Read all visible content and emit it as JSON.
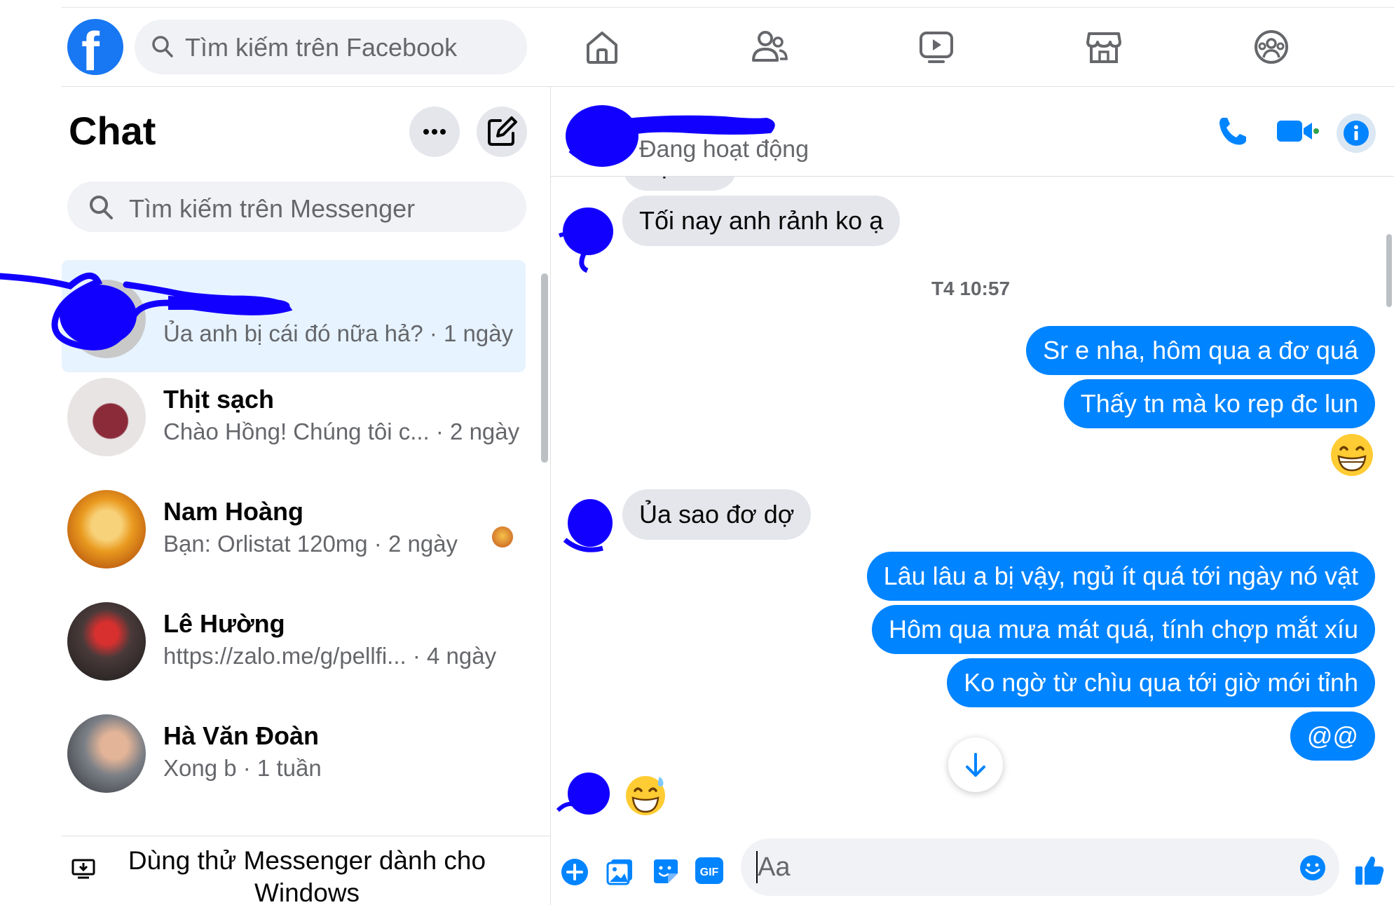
{
  "header": {
    "logo_letter": "f",
    "search_placeholder": "Tìm kiếm trên Facebook",
    "nav_icons": [
      "home-icon",
      "friends-icon",
      "watch-icon",
      "marketplace-icon",
      "groups-icon"
    ]
  },
  "sidebar": {
    "title": "Chat",
    "search_placeholder": "Tìm kiếm trên Messenger",
    "conversations": [
      {
        "name": "",
        "preview": "Ủa anh bị cái đó nữa hả? · 1 ngày",
        "active": true
      },
      {
        "name": "Thịt sạch",
        "preview": "Chào Hồng! Chúng tôi c... · 2 ngày"
      },
      {
        "name": "Nam Hoàng",
        "preview": "Bạn: Orlistat 120mg · 2 ngày"
      },
      {
        "name": "Lê Hường",
        "preview": "https://zalo.me/g/pellfi... · 4 ngày"
      },
      {
        "name": "Hà Văn Đoàn",
        "preview": "Xong b · 1 tuần"
      }
    ],
    "promo_text": "Dùng thử Messenger dành cho Windows"
  },
  "conversation": {
    "contact_status": "Đang hoạt động",
    "messages_in": [
      "Dạ anh",
      "Tối nay anh rảnh ko ạ",
      "Ủa sao đơ dợ"
    ],
    "timestamp": "T4 10:57",
    "messages_out_1": [
      "Sr e nha, hôm qua a đơ quá",
      "Thấy tn mà ko rep đc lun"
    ],
    "messages_out_2": [
      "Lâu lâu a bị vậy, ngủ ít quá tới ngày nó vật",
      "Hôm qua mưa mát quá, tính chợp mắt xíu",
      "Ko ngờ từ chìu qua tới giờ mới tỉnh",
      "@@"
    ],
    "composer_placeholder": "Aa"
  },
  "colors": {
    "brand": "#1877f2",
    "outgoing_bubble": "#0084ff",
    "incoming_bubble": "#e4e6eb",
    "active_conversation": "#e7f3ff"
  }
}
